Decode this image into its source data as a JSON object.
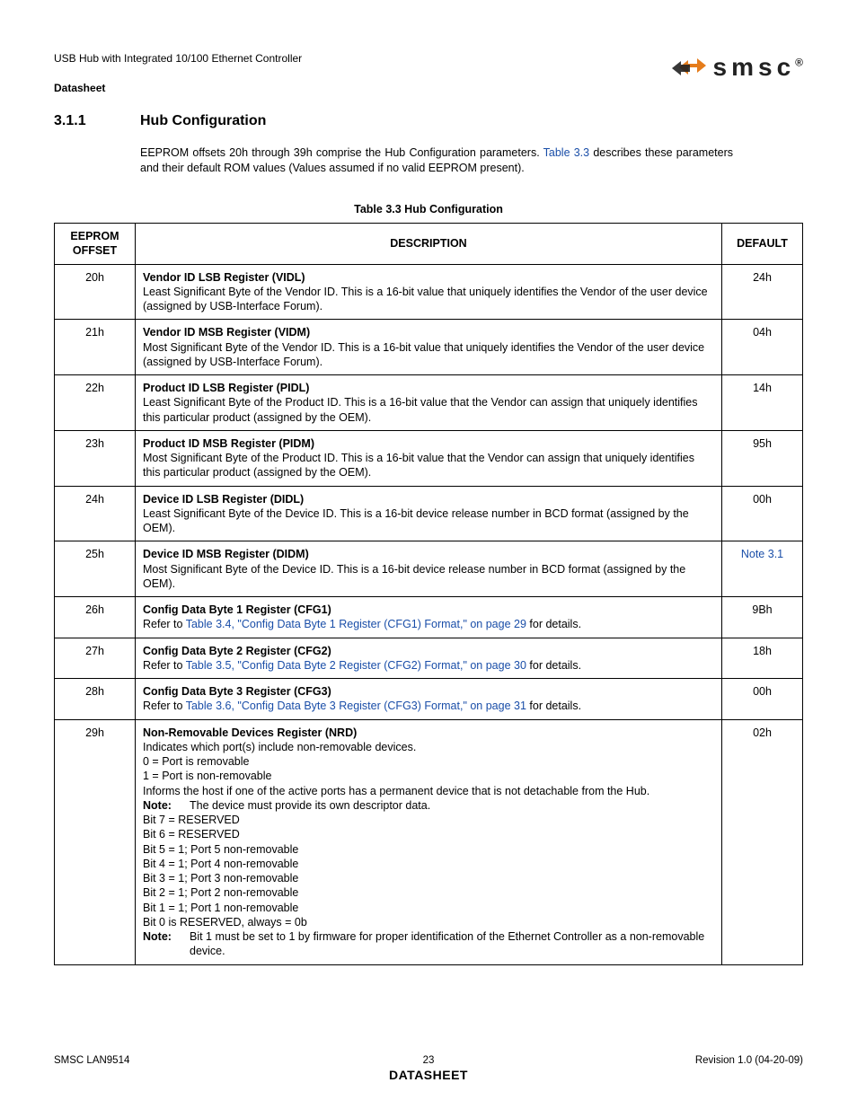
{
  "header": {
    "product_line": "USB Hub with Integrated 10/100 Ethernet Controller",
    "doc_type": "Datasheet",
    "logo_text": "smsc",
    "logo_reg": "®"
  },
  "section": {
    "number": "3.1.1",
    "title": "Hub Configuration"
  },
  "intro": {
    "pre": "EEPROM offsets 20h through 39h comprise the Hub Configuration parameters. ",
    "link": "Table 3.3",
    "post": " describes these parameters and their default ROM values (Values assumed if no valid EEPROM present)."
  },
  "table": {
    "caption": "Table 3.3 Hub Configuration",
    "head": {
      "offset_l1": "EEPROM",
      "offset_l2": "OFFSET",
      "desc": "DESCRIPTION",
      "def": "DEFAULT"
    },
    "rows": {
      "r20": {
        "offset": "20h",
        "title": "Vendor ID LSB Register (VIDL)",
        "body": "Least Significant Byte of the Vendor ID. This is a 16-bit value that uniquely identifies the Vendor of the user device (assigned by USB-Interface Forum).",
        "def": "24h"
      },
      "r21": {
        "offset": "21h",
        "title": "Vendor ID MSB Register (VIDM)",
        "body": "Most Significant Byte of the Vendor ID. This is a 16-bit value that uniquely identifies the Vendor of the user device (assigned by USB-Interface Forum).",
        "def": "04h"
      },
      "r22": {
        "offset": "22h",
        "title": "Product ID LSB Register (PIDL)",
        "body": "Least Significant Byte of the Product ID. This is a 16-bit value that the Vendor can assign that uniquely identifies this particular product (assigned by the OEM).",
        "def": "14h"
      },
      "r23": {
        "offset": "23h",
        "title": "Product ID MSB Register (PIDM)",
        "body": "Most Significant Byte of the Product ID. This is a 16-bit value that the Vendor can assign that uniquely identifies this particular product (assigned by the OEM).",
        "def": "95h"
      },
      "r24": {
        "offset": "24h",
        "title": "Device ID LSB Register (DIDL)",
        "body": "Least Significant Byte of the Device ID. This is a 16-bit device release number in BCD format (assigned by the OEM).",
        "def": "00h"
      },
      "r25": {
        "offset": "25h",
        "title": "Device ID MSB Register (DIDM)",
        "body": "Most Significant Byte of the Device ID. This is a 16-bit device release number in BCD format (assigned by the OEM).",
        "def": "Note 3.1"
      },
      "r26": {
        "offset": "26h",
        "title": "Config Data Byte 1 Register (CFG1)",
        "pre": "Refer to ",
        "link": "Table 3.4, \"Config Data Byte 1 Register (CFG1) Format,\" on page 29",
        "post": " for details.",
        "def": "9Bh"
      },
      "r27": {
        "offset": "27h",
        "title": "Config Data Byte 2 Register (CFG2)",
        "pre": "Refer to ",
        "link": "Table 3.5, \"Config Data Byte 2 Register (CFG2) Format,\" on page 30",
        "post": " for details.",
        "def": "18h"
      },
      "r28": {
        "offset": "28h",
        "title": "Config Data Byte 3 Register (CFG3)",
        "pre": "Refer to ",
        "link": "Table 3.6, \"Config Data Byte 3 Register (CFG3) Format,\" on page 31",
        "post": " for details.",
        "def": "00h"
      },
      "r29": {
        "offset": "29h",
        "title": "Non-Removable Devices Register (NRD)",
        "line1": "Indicates which port(s) include non-removable devices.",
        "line2": "0 = Port is removable",
        "line3": "1 = Port is non-removable",
        "line4": "Informs the host if one of the active ports has a permanent device that is not detachable from the Hub.",
        "note1_label": "Note:",
        "note1_text": "The device must provide its own descriptor data.",
        "bit7": "Bit 7 = RESERVED",
        "bit6": "Bit 6 = RESERVED",
        "bit5": "Bit 5 = 1; Port 5 non-removable",
        "bit4": "Bit 4 = 1; Port 4 non-removable",
        "bit3": "Bit 3 = 1; Port 3 non-removable",
        "bit2": "Bit 2 = 1; Port 2 non-removable",
        "bit1": "Bit 1 = 1; Port 1 non-removable",
        "bit0": "Bit 0 is RESERVED, always = 0b",
        "note2_label": "Note:",
        "note2_text": "Bit 1 must be set to 1 by firmware for proper identification of the Ethernet Controller as a non-removable device.",
        "def": "02h"
      }
    }
  },
  "footer": {
    "left": "SMSC LAN9514",
    "page": "23",
    "right": "Revision 1.0 (04-20-09)",
    "ds": "DATASHEET"
  }
}
